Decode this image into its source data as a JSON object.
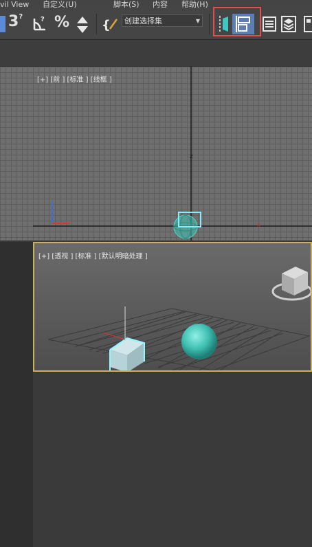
{
  "menubar": {
    "items": [
      "vil View",
      "自定义(U)",
      "脚本(S)",
      "内容",
      "帮助(H)"
    ]
  },
  "toolbar": {
    "selection_set": {
      "value": "创建选择集"
    },
    "snap_angle_label": "3",
    "percent_label": "%",
    "highlight_color": "#e0514d"
  },
  "viewports": {
    "front": {
      "label": "[+] [前 ] [标准 ] [线框 ]",
      "axis_z": "z",
      "axis_x": "x"
    },
    "perspective": {
      "label": "[+] [透视 ] [标准 ] [默认明暗处理 ]",
      "active_border_color": "#c9b25b"
    }
  },
  "colors": {
    "object_teal": "#4fd1c5",
    "selection_cyan": "#7ff0ff"
  }
}
